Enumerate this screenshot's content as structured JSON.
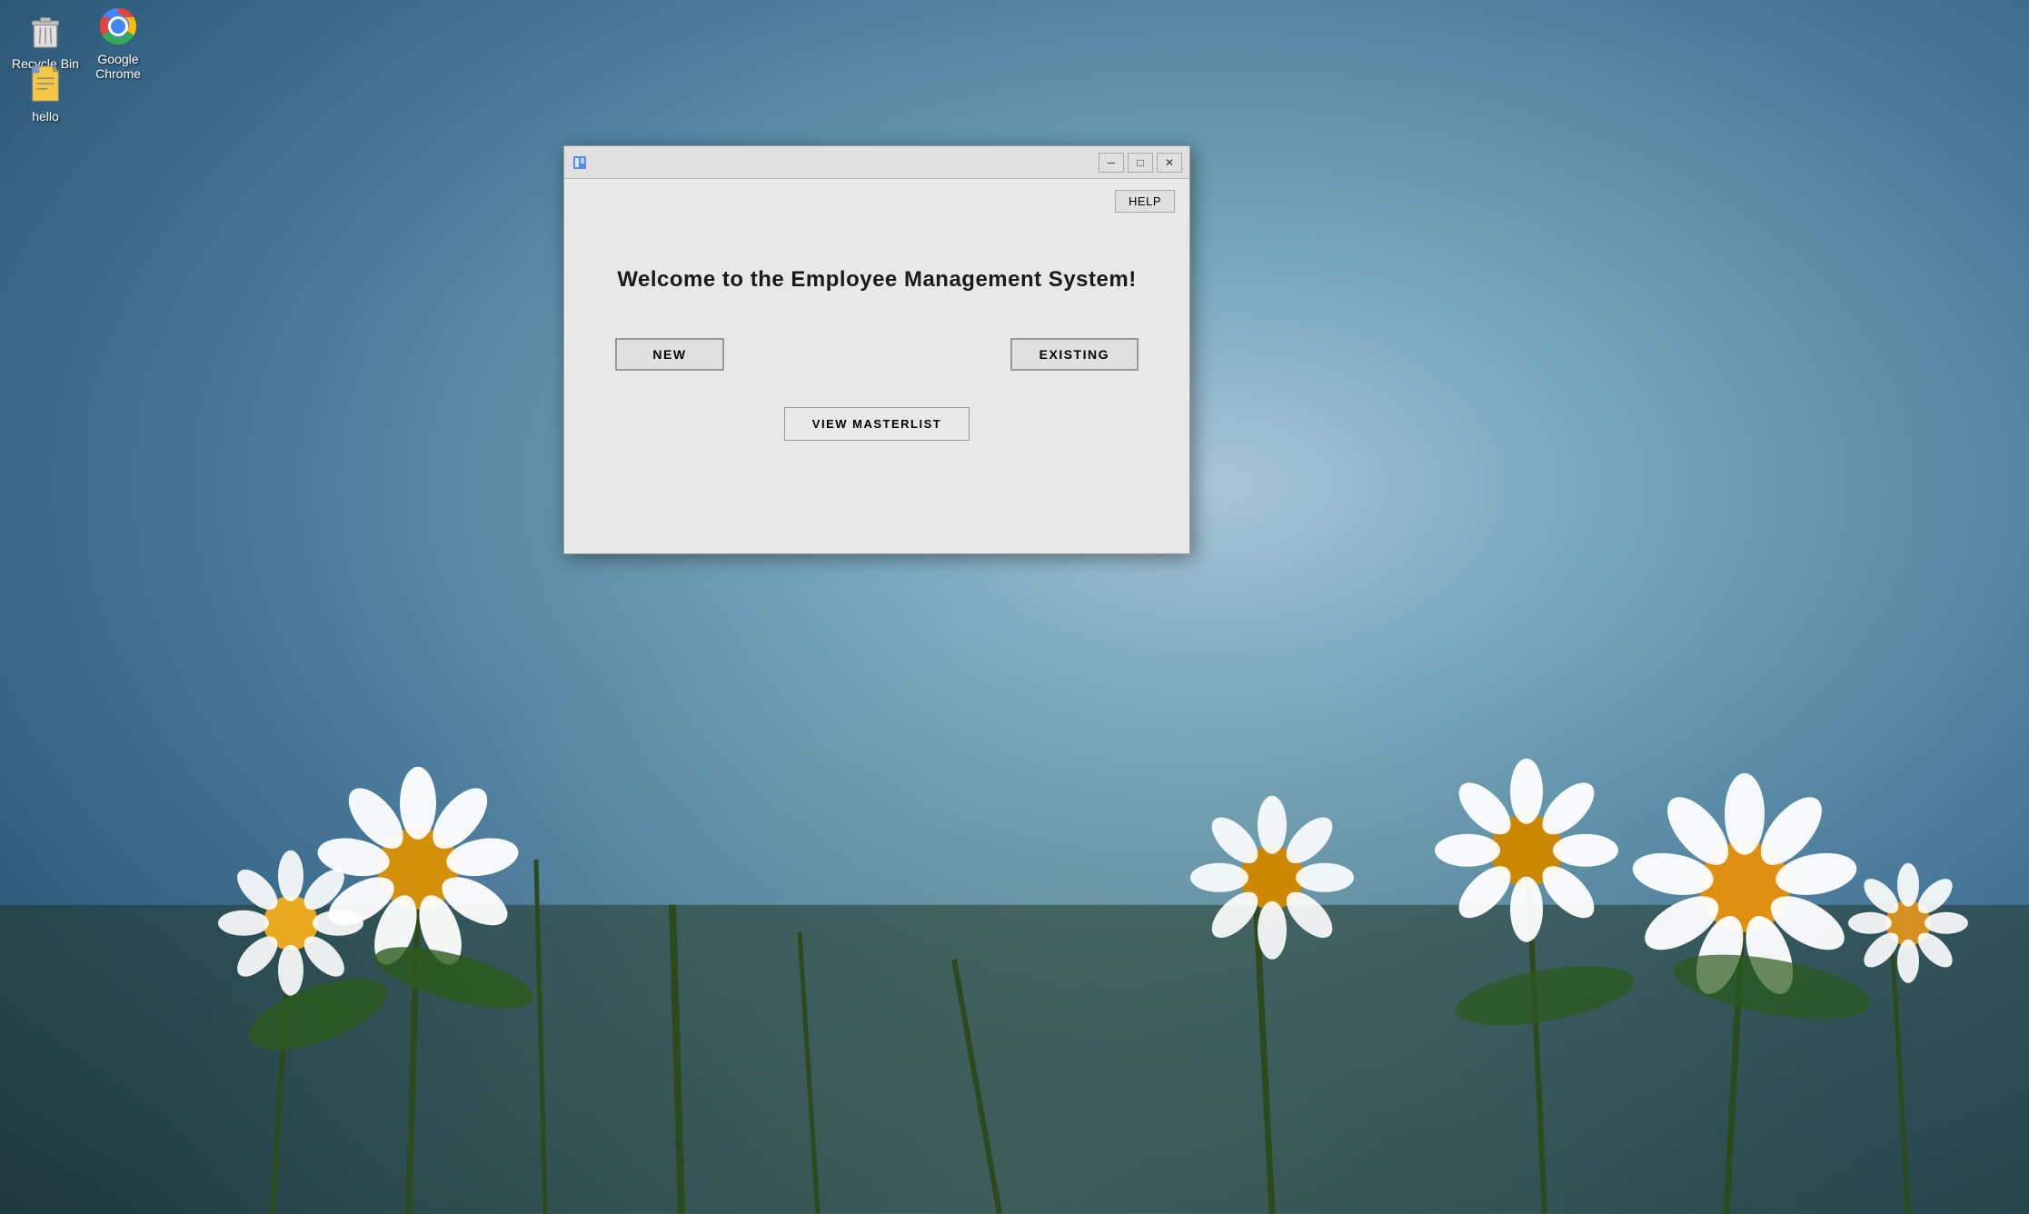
{
  "desktop": {
    "background_desc": "Windows desktop with blue sky and daisies"
  },
  "icons": {
    "recycle_bin": {
      "label": "Recycle Bin"
    },
    "google_chrome": {
      "label": "Google Chrome"
    },
    "hello_file": {
      "label": "hello"
    }
  },
  "window": {
    "title": "",
    "help_label": "HELP",
    "welcome_text": "Welcome to the Employee Management System!",
    "new_label": "NEW",
    "existing_label": "EXISTING",
    "view_masterlist_label": "VIEW MASTERLIST",
    "controls": {
      "minimize": "─",
      "maximize": "□",
      "close": "✕"
    }
  }
}
